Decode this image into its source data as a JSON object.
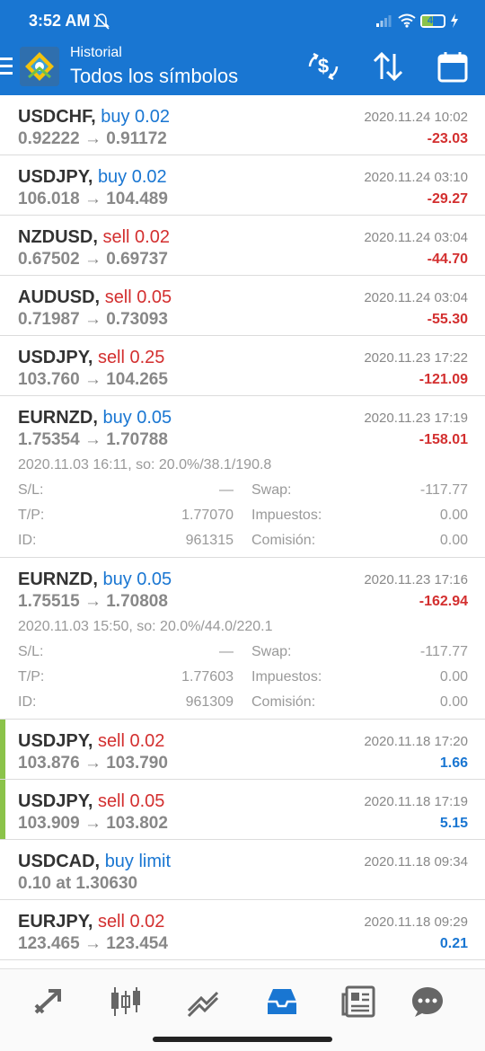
{
  "status": {
    "time": "3:52 AM",
    "battery": "49",
    "battery_level_percent": 49
  },
  "header": {
    "subtitle": "Historial",
    "title": "Todos los símbolos"
  },
  "actions": [
    "currency-exchange-icon",
    "sort-icon",
    "calendar-icon"
  ],
  "trades": [
    {
      "symbol": "USDCHF,",
      "side": "buy",
      "volume": "buy 0.02",
      "prices": "0.92222 → 0.91172",
      "date": "2020.11.24 10:02",
      "profit": "-23.03",
      "profit_sign": "neg"
    },
    {
      "symbol": "USDJPY,",
      "side": "buy",
      "volume": "buy 0.02",
      "prices": "106.018 → 104.489",
      "date": "2020.11.24 03:10",
      "profit": "-29.27",
      "profit_sign": "neg"
    },
    {
      "symbol": "NZDUSD,",
      "side": "sell",
      "volume": "sell 0.02",
      "prices": "0.67502 → 0.69737",
      "date": "2020.11.24 03:04",
      "profit": "-44.70",
      "profit_sign": "neg"
    },
    {
      "symbol": "AUDUSD,",
      "side": "sell",
      "volume": "sell 0.05",
      "prices": "0.71987 → 0.73093",
      "date": "2020.11.24 03:04",
      "profit": "-55.30",
      "profit_sign": "neg"
    },
    {
      "symbol": "USDJPY,",
      "side": "sell",
      "volume": "sell 0.25",
      "prices": "103.760 → 104.265",
      "date": "2020.11.23 17:22",
      "profit": "-121.09",
      "profit_sign": "neg"
    },
    {
      "symbol": "EURNZD,",
      "side": "buy",
      "volume": "buy 0.05",
      "prices": "1.75354 → 1.70788",
      "date": "2020.11.23 17:19",
      "profit": "-158.01",
      "profit_sign": "neg",
      "details": {
        "line": "2020.11.03 16:11, so: 20.0%/38.1/190.8",
        "sl_label": "S/L:",
        "sl": "—",
        "tp_label": "T/P:",
        "tp": "1.77070",
        "id_label": "ID:",
        "id": "961315",
        "swap_label": "Swap:",
        "swap": "-117.77",
        "tax_label": "Impuestos:",
        "tax": "0.00",
        "comm_label": "Comisión:",
        "comm": "0.00"
      }
    },
    {
      "symbol": "EURNZD,",
      "side": "buy",
      "volume": "buy 0.05",
      "prices": "1.75515 → 1.70808",
      "date": "2020.11.23 17:16",
      "profit": "-162.94",
      "profit_sign": "neg",
      "details": {
        "line": "2020.11.03 15:50, so: 20.0%/44.0/220.1",
        "sl_label": "S/L:",
        "sl": "—",
        "tp_label": "T/P:",
        "tp": "1.77603",
        "id_label": "ID:",
        "id": "961309",
        "swap_label": "Swap:",
        "swap": "-117.77",
        "tax_label": "Impuestos:",
        "tax": "0.00",
        "comm_label": "Comisión:",
        "comm": "0.00"
      }
    },
    {
      "symbol": "USDJPY,",
      "side": "sell",
      "volume": "sell 0.02",
      "prices": "103.876 → 103.790",
      "date": "2020.11.18 17:20",
      "profit": "1.66",
      "profit_sign": "pos",
      "highlight": true
    },
    {
      "symbol": "USDJPY,",
      "side": "sell",
      "volume": "sell 0.05",
      "prices": "103.909 → 103.802",
      "date": "2020.11.18 17:19",
      "profit": "5.15",
      "profit_sign": "pos",
      "highlight": true
    },
    {
      "symbol": "USDCAD,",
      "side": "buy",
      "volume": "buy limit",
      "prices": "0.10 at 1.30630",
      "date": "2020.11.18 09:34",
      "profit": "",
      "profit_sign": "pos"
    },
    {
      "symbol": "EURJPY,",
      "side": "sell",
      "volume": "sell 0.02",
      "prices": "123.465 → 123.454",
      "date": "2020.11.18 09:29",
      "profit": "0.21",
      "profit_sign": "pos"
    }
  ],
  "bottom_nav": [
    "quotes-icon",
    "chart-icon",
    "trade-icon",
    "history-icon",
    "news-icon",
    "chat-icon"
  ],
  "colors": {
    "accent": "#1976d2",
    "sell": "#d32f2f",
    "highlight": "#8bc34a"
  }
}
